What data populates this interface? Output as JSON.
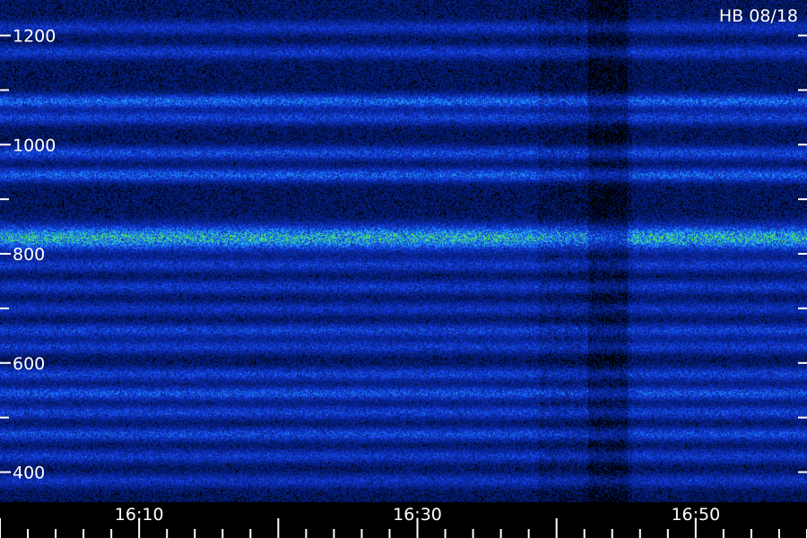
{
  "header": {
    "station_label": "HB 08/18"
  },
  "chart_data": {
    "type": "heatmap",
    "title": "",
    "xlabel": "",
    "ylabel": "",
    "x_ticks": [
      "16:10",
      "16:30",
      "16:50"
    ],
    "x_tick_minutes": [
      10,
      30,
      50
    ],
    "x_range_minutes": [
      0,
      58
    ],
    "y_ticks": [
      400,
      600,
      800,
      1000,
      1200
    ],
    "ylim": [
      345,
      1265
    ],
    "colors": {
      "background": "#000000",
      "low": "#1a1aa0",
      "mid": "#1f6fff",
      "high": "#4cf04c"
    },
    "bands": [
      {
        "freq": 1215,
        "intensity": 0.3
      },
      {
        "freq": 1170,
        "intensity": 0.35
      },
      {
        "freq": 1080,
        "intensity": 0.6
      },
      {
        "freq": 1050,
        "intensity": 0.4
      },
      {
        "freq": 985,
        "intensity": 0.45
      },
      {
        "freq": 945,
        "intensity": 0.55
      },
      {
        "freq": 830,
        "intensity": 0.95
      },
      {
        "freq": 780,
        "intensity": 0.35
      },
      {
        "freq": 740,
        "intensity": 0.35
      },
      {
        "freq": 700,
        "intensity": 0.3
      },
      {
        "freq": 660,
        "intensity": 0.4
      },
      {
        "freq": 630,
        "intensity": 0.35
      },
      {
        "freq": 580,
        "intensity": 0.4
      },
      {
        "freq": 545,
        "intensity": 0.5
      },
      {
        "freq": 510,
        "intensity": 0.4
      },
      {
        "freq": 470,
        "intensity": 0.45
      },
      {
        "freq": 430,
        "intensity": 0.35
      },
      {
        "freq": 385,
        "intensity": 0.3
      }
    ]
  }
}
